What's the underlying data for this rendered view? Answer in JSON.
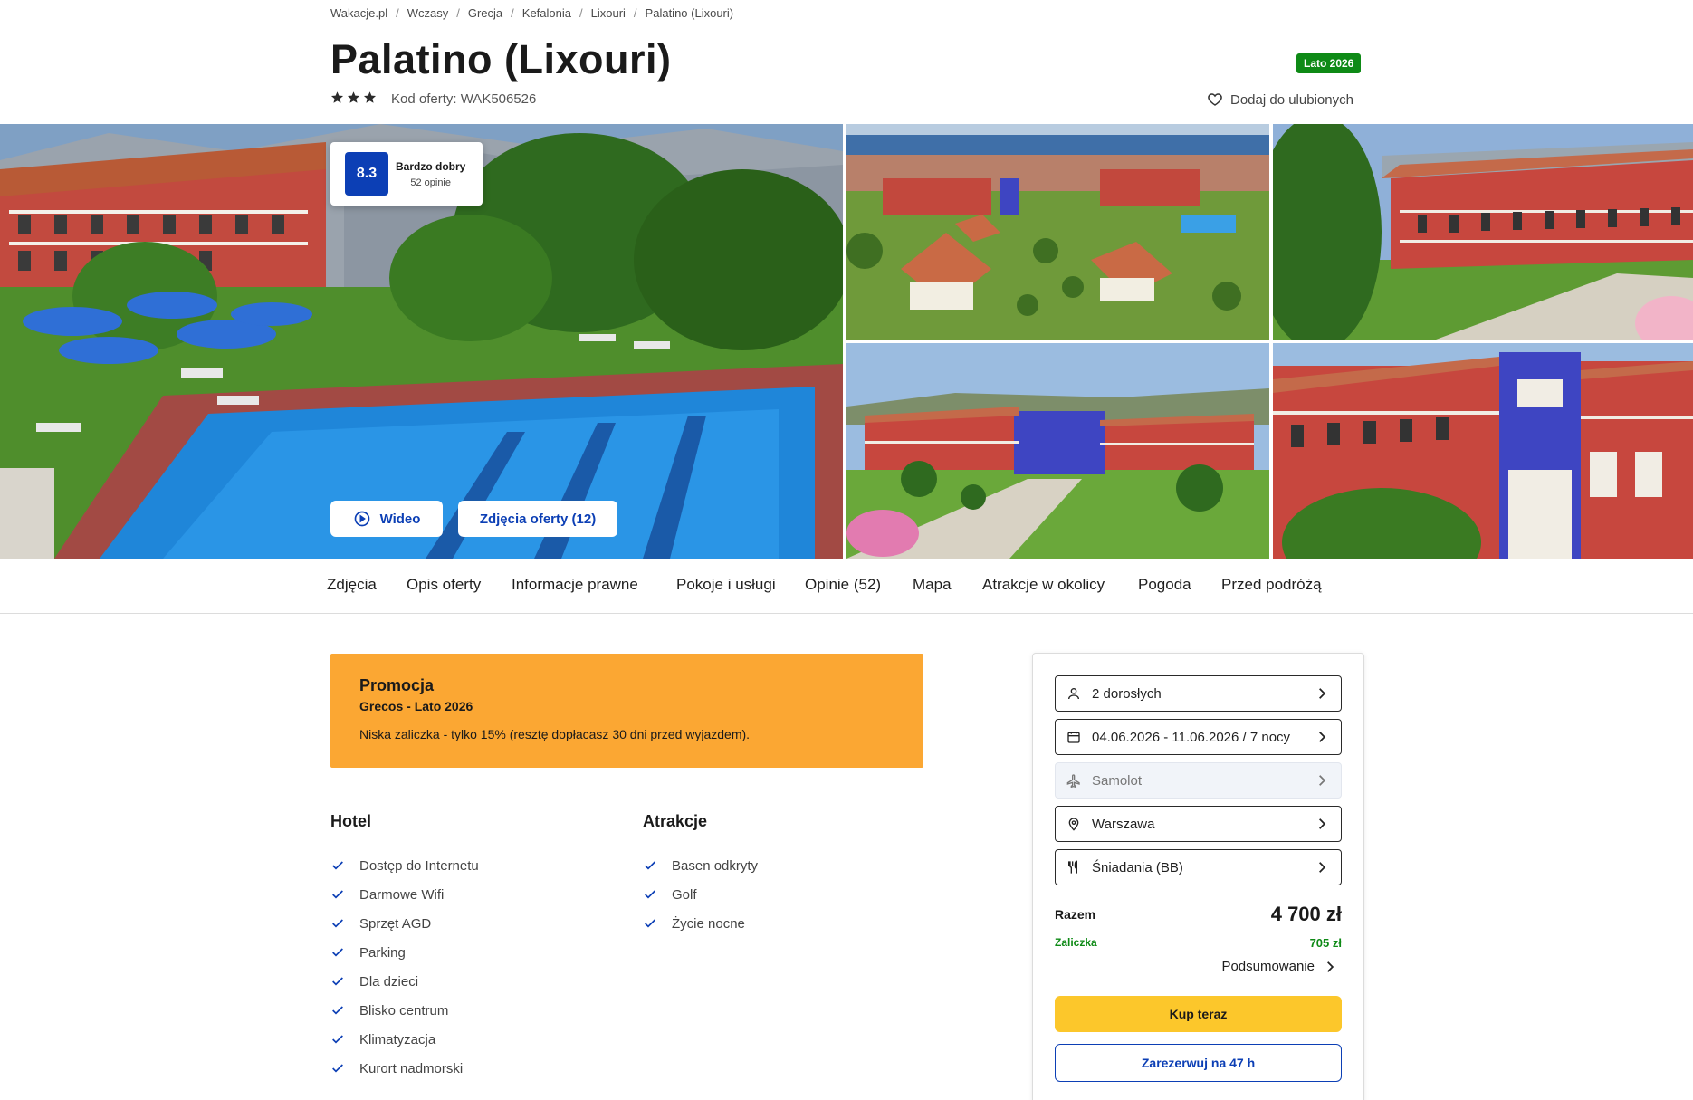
{
  "breadcrumb": [
    "Wakacje.pl",
    "Wczasy",
    "Grecja",
    "Kefalonia",
    "Lixouri",
    "Palatino (Lixouri)"
  ],
  "breadcrumb_separator": "/",
  "title": "Palatino (Lixouri)",
  "season_badge": "Lato 2026",
  "stars": 3,
  "offer_code": "Kod oferty: WAK506526",
  "favourite_label": "Dodaj do ulubionych",
  "rating": {
    "score": "8.3",
    "label": "Bardzo dobry",
    "count": "52 opinie"
  },
  "gallery_buttons": {
    "video": "Wideo",
    "photos": "Zdjęcia oferty (12)"
  },
  "tabs": [
    "Zdjęcia",
    "Opis oferty",
    "Informacje prawne",
    "Pokoje i usługi",
    "Opinie (52)",
    "Mapa",
    "Atrakcje w okolicy",
    "Pogoda",
    "Przed podróżą"
  ],
  "promo": {
    "title": "Promocja",
    "subtitle": "Grecos - Lato 2026",
    "text": "Niska zaliczka - tylko 15% (resztę dopłacasz 30 dni przed wyjazdem)."
  },
  "amenities": {
    "hotel": {
      "heading": "Hotel",
      "items": [
        "Dostęp do Internetu",
        "Darmowe Wifi",
        "Sprzęt AGD",
        "Parking",
        "Dla dzieci",
        "Blisko centrum",
        "Klimatyzacja",
        "Kurort nadmorski"
      ]
    },
    "attractions": {
      "heading": "Atrakcje",
      "items": [
        "Basen odkryty",
        "Golf",
        "Życie nocne"
      ]
    }
  },
  "booking": {
    "options": [
      {
        "label": "2 dorosłych",
        "icon": "person-icon",
        "disabled": false
      },
      {
        "label": "04.06.2026 - 11.06.2026 / 7 nocy",
        "icon": "calendar-icon",
        "disabled": false
      },
      {
        "label": "Samolot",
        "icon": "plane-icon",
        "disabled": true
      },
      {
        "label": "Warszawa",
        "icon": "location-pin-icon",
        "disabled": false
      },
      {
        "label": "Śniadania (BB)",
        "icon": "cutlery-icon",
        "disabled": false
      }
    ],
    "total_label": "Razem",
    "total_value": "4 700 zł",
    "deposit_label": "Zaliczka",
    "deposit_value": "705 zł",
    "summary_label": "Podsumowanie",
    "buy_label": "Kup teraz",
    "reserve_label": "Zarezerwuj na 47 h"
  },
  "colors": {
    "brand_blue": "#0c3fb5",
    "badge_green": "#0e8a16",
    "promo_orange": "#fba733",
    "buy_yellow": "#fcc72b"
  }
}
